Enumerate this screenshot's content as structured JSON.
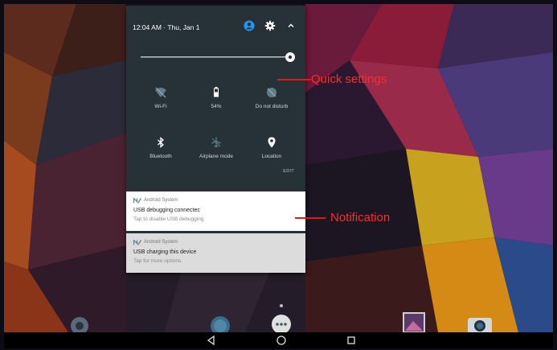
{
  "status_bar": {
    "time_date": "12:04 AM · Thu, Jan 1"
  },
  "quick_settings": {
    "tiles": [
      {
        "label": "Wi-Fi",
        "icon": "wifi-off-icon"
      },
      {
        "label": "54%",
        "icon": "battery-icon"
      },
      {
        "label": "Do not disturb",
        "icon": "do-not-disturb-icon"
      },
      {
        "label": "Bluetooth",
        "icon": "bluetooth-icon"
      },
      {
        "label": "Airplane mode",
        "icon": "airplane-icon"
      },
      {
        "label": "Location",
        "icon": "location-pin-icon"
      }
    ],
    "edit_label": "EDIT",
    "brightness_level": 0.95
  },
  "notifications": [
    {
      "app": "Android System",
      "title": "USB debugging connectec",
      "text": "Tap to disable USB debugging"
    },
    {
      "app": "Android System",
      "title": "USB charging this device",
      "text": "Tap for more options."
    }
  ],
  "annotations": {
    "quick_settings_label": "Quick settings",
    "notification_label": "Notification"
  },
  "colors": {
    "shade_background": "#263238",
    "accent": "#2196f3",
    "callout_red": "#ff2a2a"
  },
  "navbar": {
    "back_icon": "back-triangle-icon",
    "home_icon": "home-circle-icon",
    "recents_icon": "recents-square-icon"
  }
}
